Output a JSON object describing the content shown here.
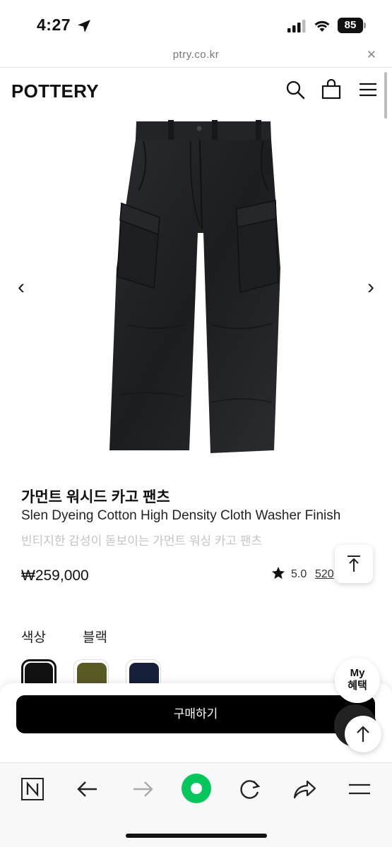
{
  "status_bar": {
    "time": "4:27",
    "battery": "85"
  },
  "browser": {
    "url": "ptry.co.kr",
    "close_icon": "close-icon"
  },
  "site": {
    "logo": "POTTERY",
    "icons": [
      "search-icon",
      "bag-icon",
      "menu-icon"
    ]
  },
  "product": {
    "image_icon": "cargo-pants-image",
    "title_ko": "가먼트 워시드 카고 팬츠",
    "title_en": "Slen Dyeing Cotton High Density Cloth Washer Finish",
    "subtitle": "빈티지한 감성이 돋보이는 가먼트 워싱 카고 팬츠",
    "price": "₩259,000",
    "rating": "5.0",
    "review_count": "520",
    "color_label": "색상",
    "color_value": "블랙",
    "swatches": [
      {
        "name": "black",
        "color": "#111111"
      },
      {
        "name": "olive",
        "color": "#5a5a24"
      },
      {
        "name": "navy",
        "color": "#16203a"
      }
    ]
  },
  "actions": {
    "buy_label": "구매하기",
    "my_benefit_line1": "My",
    "my_benefit_line2": "혜택"
  },
  "toolbar": {
    "accent": "#03c75a",
    "icons": [
      "naver-n-icon",
      "back-icon",
      "forward-icon",
      "green-dot-icon",
      "refresh-icon",
      "share-icon",
      "menu-icon"
    ]
  }
}
